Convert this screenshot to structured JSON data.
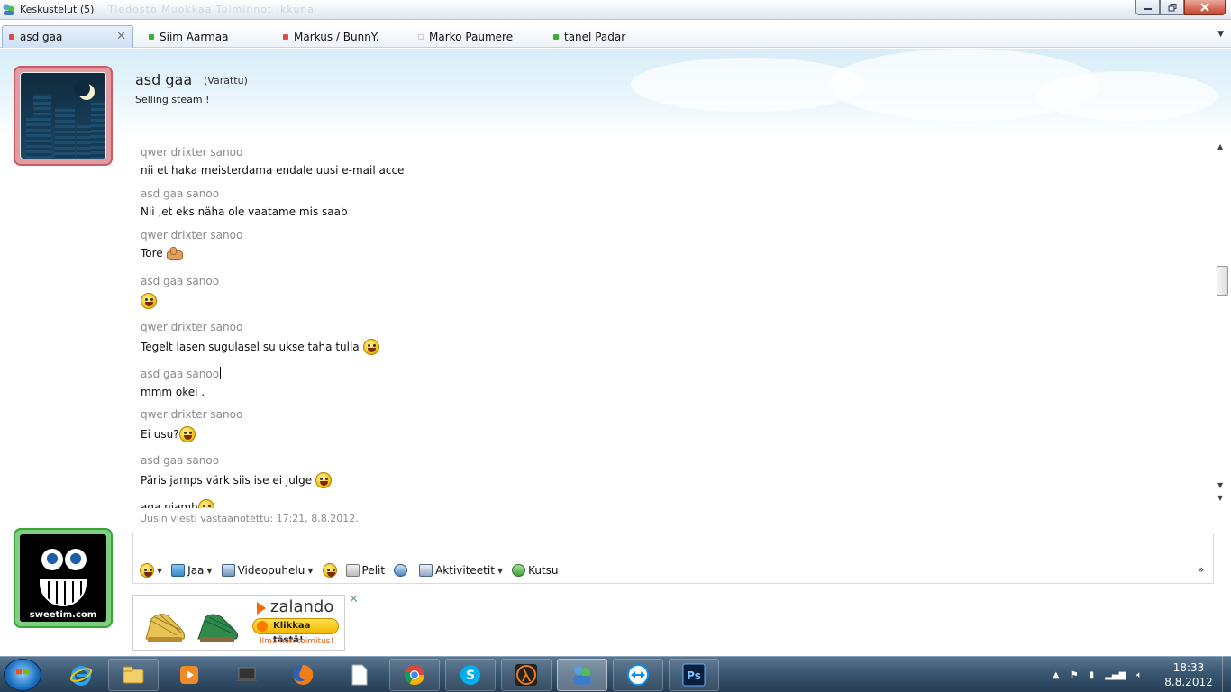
{
  "window": {
    "title": "Keskustelut (5)",
    "ghost_menu": "Tiedosto   Muokkaa   Toiminnot   Ikkuna"
  },
  "tabs": [
    {
      "label": "asd gaa",
      "status_color": "#e04a4a",
      "active": true
    },
    {
      "label": "Siim Aarmaa",
      "status_color": "#33b333",
      "active": false
    },
    {
      "label": "Markus / BunnY.",
      "status_color": "#e04a4a",
      "active": false
    },
    {
      "label": "Marko Paumere",
      "status_color": "#d0d0d0",
      "active": false
    },
    {
      "label": "tanel Padar",
      "status_color": "#33b333",
      "active": false
    }
  ],
  "contact": {
    "name": "asd gaa",
    "status": "(Varattu)",
    "personal_message": "Selling steam !"
  },
  "messages": [
    {
      "sender": "qwer drixter sanoo",
      "text": "nii et haka meisterdama endale uusi e-mail acce",
      "emoticon": ""
    },
    {
      "sender": "asd gaa sanoo",
      "text": "Nii ,et eks näha ole vaatame mis saab",
      "emoticon": ""
    },
    {
      "sender": "qwer drixter sanoo",
      "text": "Tore",
      "emoticon": "thumbs-up"
    },
    {
      "sender": "asd gaa sanoo",
      "text": "",
      "emoticon": "smiley"
    },
    {
      "sender": "qwer drixter sanoo",
      "text": "Tegelt lasen sugulasel su ukse taha tulla",
      "emoticon": "grin"
    },
    {
      "sender": "asd gaa sanoo",
      "text": "mmm okei .",
      "emoticon": ""
    },
    {
      "sender": "qwer drixter sanoo",
      "text": "Ei usu?",
      "emoticon": "grin"
    },
    {
      "sender": "asd gaa sanoo",
      "text": "Päris jamps värk siis ise ei julge",
      "emoticon": "grin"
    },
    {
      "sender": "",
      "text": "aga niamh",
      "emoticon": "grin"
    }
  ],
  "last_received": "Uusin viesti vastaanotettu: 17:21, 8.8.2012.",
  "input": {
    "value": "",
    "placeholder": ""
  },
  "toolbar": {
    "share": "Jaa",
    "video_call": "Videopuhelu",
    "games": "Pelit",
    "activities": "Aktiviteetit",
    "invite": "Kutsu",
    "more": "»"
  },
  "own_avatar": {
    "label": "sweetim.com"
  },
  "ad": {
    "brand": "zalando",
    "cta": "Klikkaa tästä!",
    "sub": "Ilmainen toimitus!"
  },
  "taskbar": {
    "time": "18:33",
    "date": "8.8.2012",
    "apps": [
      "internet-explorer",
      "file-explorer",
      "media-player",
      "laptop",
      "firefox",
      "document",
      "chrome",
      "skype",
      "half-life",
      "messenger",
      "teamviewer",
      "photoshop"
    ]
  },
  "colors": {
    "accent": "#1c6fbf",
    "sender_gray": "#8a8a8a",
    "busy_red": "#e04a4a",
    "online_green": "#33b333"
  }
}
